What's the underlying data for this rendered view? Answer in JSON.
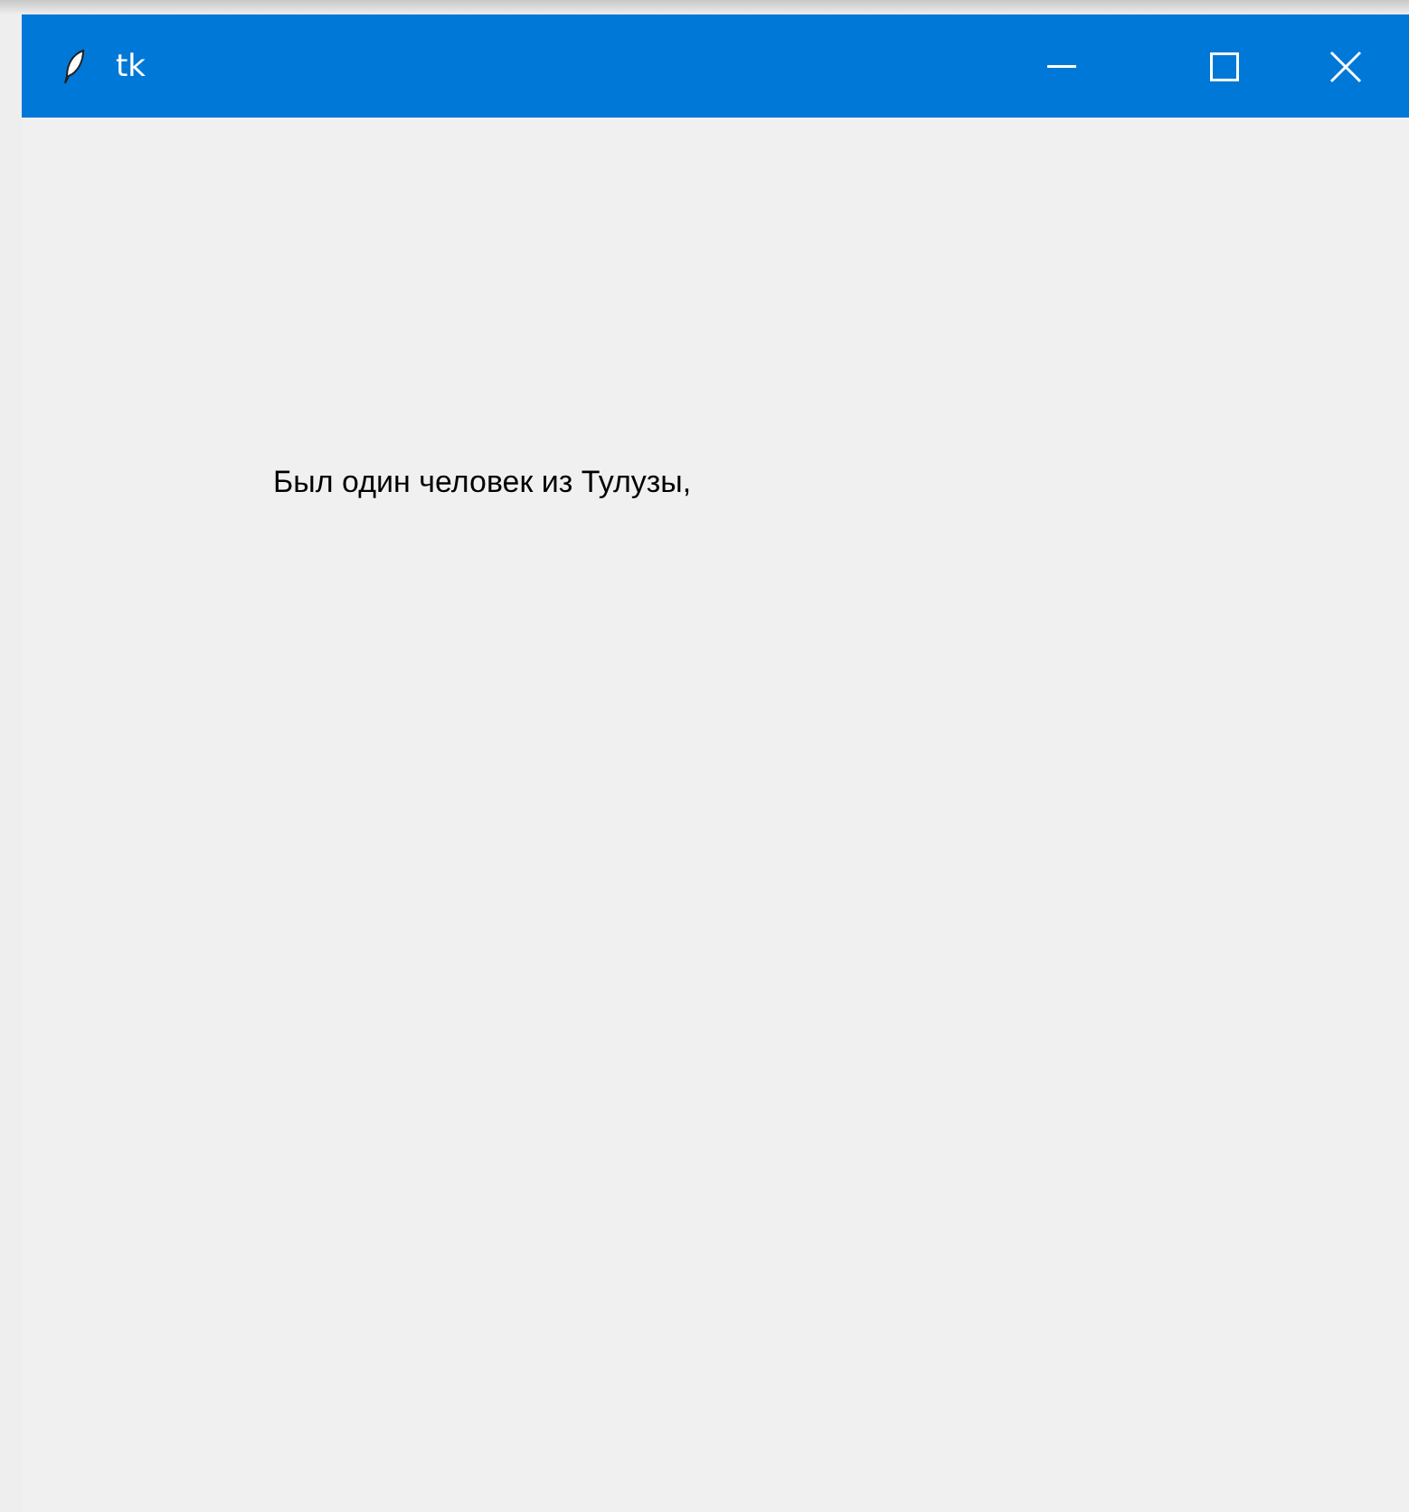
{
  "window": {
    "title": "tk"
  },
  "label": {
    "text": "Был один человек из Тулузы,"
  }
}
